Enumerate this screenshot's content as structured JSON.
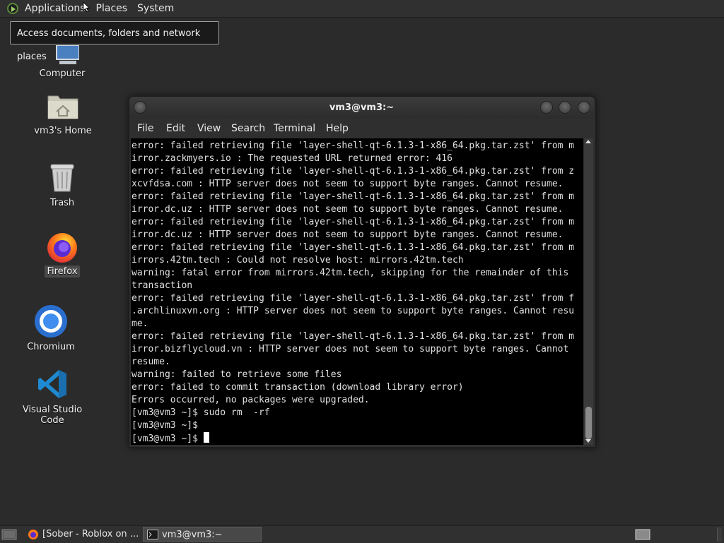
{
  "top_panel": {
    "menus": [
      "Applications",
      "Places",
      "System"
    ],
    "tooltip": "Access documents, folders and network places"
  },
  "desktop_icons": [
    {
      "label": "Computer",
      "icon": "computer-icon"
    },
    {
      "label": "vm3's Home",
      "icon": "home-folder-icon"
    },
    {
      "label": "Trash",
      "icon": "trash-icon"
    },
    {
      "label": "Firefox",
      "icon": "firefox-icon"
    },
    {
      "label": "Chromium",
      "icon": "chromium-icon"
    },
    {
      "label": "Visual Studio Code",
      "icon": "vscode-icon"
    }
  ],
  "terminal": {
    "title": "vm3@vm3:~",
    "menu": [
      "File",
      "Edit",
      "View",
      "Search",
      "Terminal",
      "Help"
    ],
    "lines": [
      "error: failed retrieving file 'layer-shell-qt-6.1.3-1-x86_64.pkg.tar.zst' from m",
      "irror.zackmyers.io : The requested URL returned error: 416",
      "error: failed retrieving file 'layer-shell-qt-6.1.3-1-x86_64.pkg.tar.zst' from z",
      "xcvfdsa.com : HTTP server does not seem to support byte ranges. Cannot resume.",
      "error: failed retrieving file 'layer-shell-qt-6.1.3-1-x86_64.pkg.tar.zst' from m",
      "irror.dc.uz : HTTP server does not seem to support byte ranges. Cannot resume.",
      "error: failed retrieving file 'layer-shell-qt-6.1.3-1-x86_64.pkg.tar.zst' from m",
      "irror.dc.uz : HTTP server does not seem to support byte ranges. Cannot resume.",
      "error: failed retrieving file 'layer-shell-qt-6.1.3-1-x86_64.pkg.tar.zst' from m",
      "irrors.42tm.tech : Could not resolve host: mirrors.42tm.tech",
      "warning: fatal error from mirrors.42tm.tech, skipping for the remainder of this",
      "transaction",
      "error: failed retrieving file 'layer-shell-qt-6.1.3-1-x86_64.pkg.tar.zst' from f",
      ".archlinuxvn.org : HTTP server does not seem to support byte ranges. Cannot resu",
      "me.",
      "error: failed retrieving file 'layer-shell-qt-6.1.3-1-x86_64.pkg.tar.zst' from m",
      "irror.bizflycloud.vn : HTTP server does not seem to support byte ranges. Cannot",
      "resume.",
      "warning: failed to retrieve some files",
      "error: failed to commit transaction (download library error)",
      "Errors occurred, no packages were upgraded.",
      "[vm3@vm3 ~]$ sudo rm  -rf",
      "[vm3@vm3 ~]$",
      "[vm3@vm3 ~]$ "
    ]
  },
  "taskbar": {
    "tasks": [
      {
        "label": "[Sober - Roblox on ...",
        "icon": "firefox-icon",
        "active": false
      },
      {
        "label": "vm3@vm3:~",
        "icon": "terminal-icon",
        "active": true
      }
    ]
  }
}
